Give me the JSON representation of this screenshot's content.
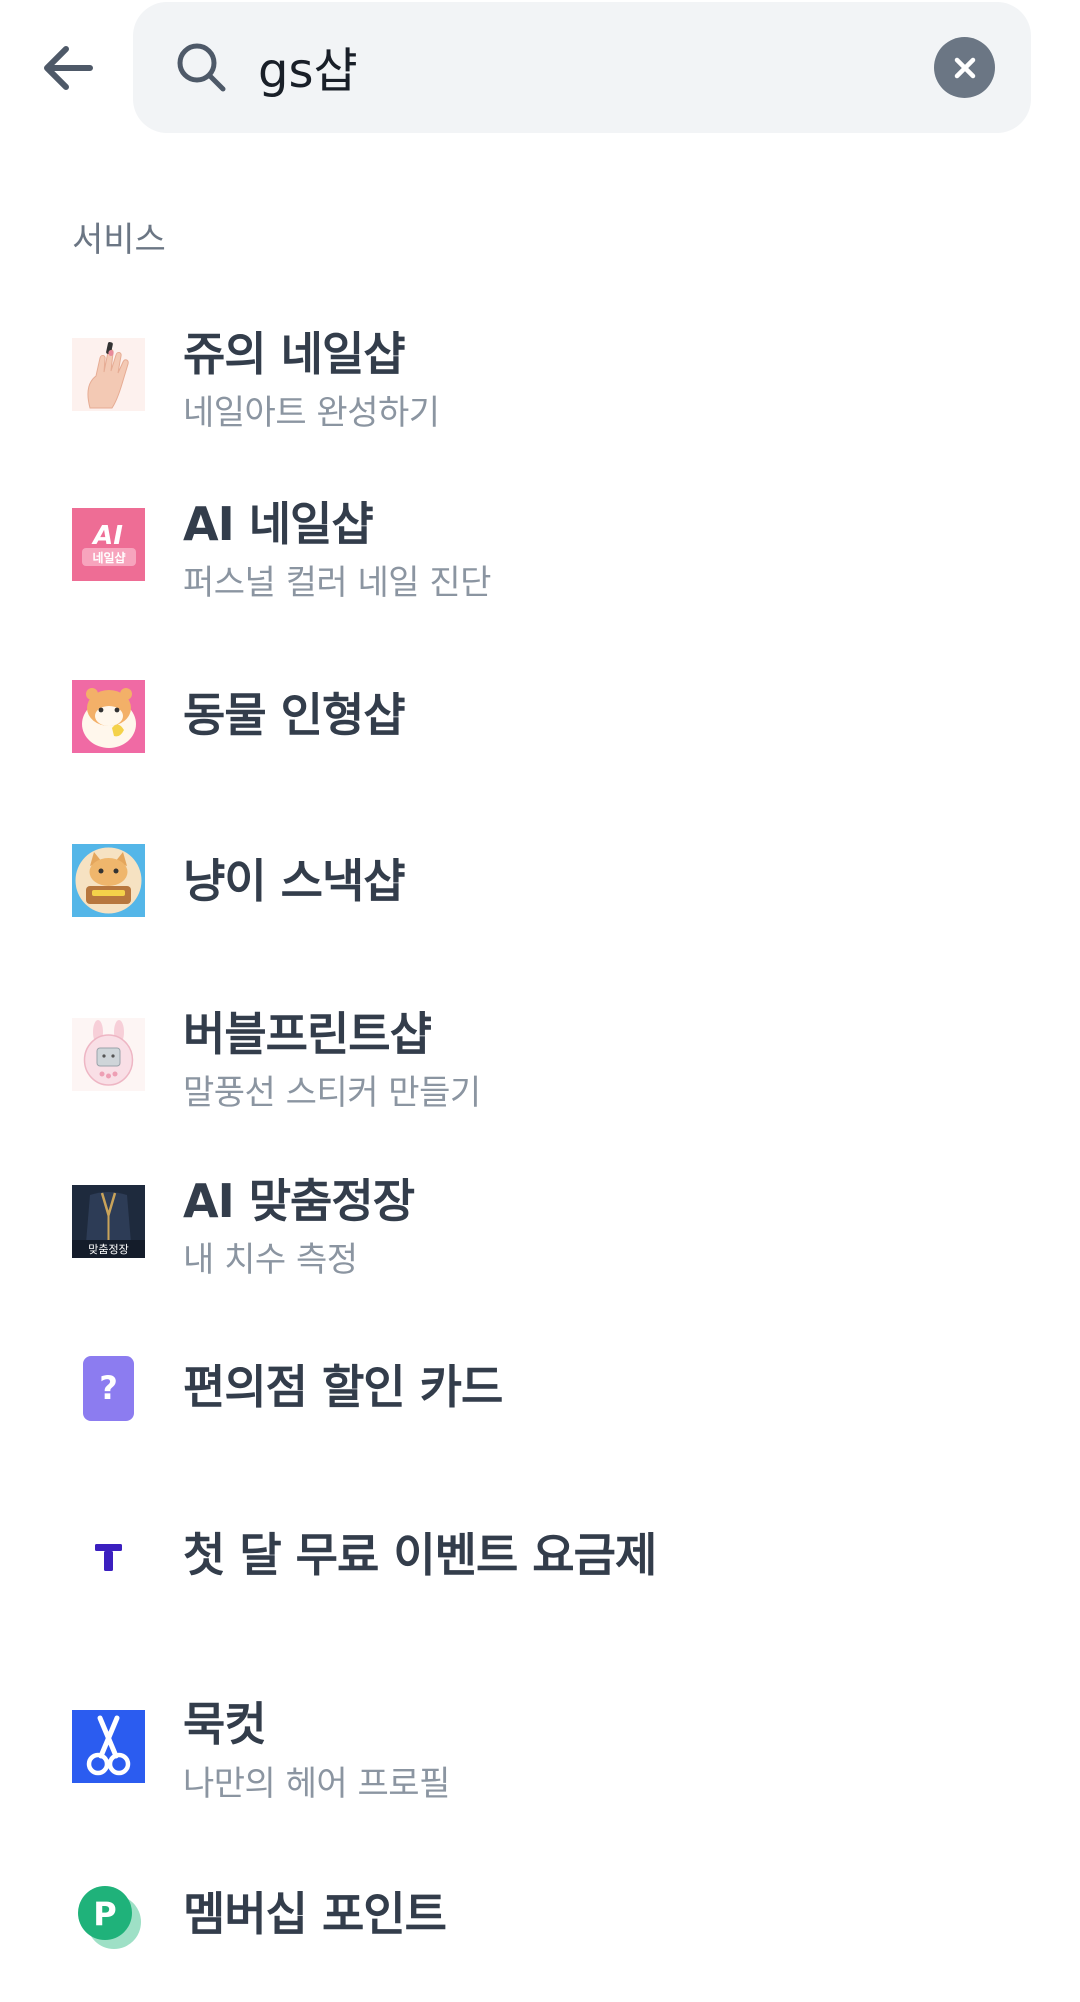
{
  "search": {
    "query": "gs샵"
  },
  "section": {
    "title": "서비스"
  },
  "results": [
    {
      "title": "쥬의 네일샵",
      "subtitle": "네일아트 완성하기",
      "icon": "nail-hand-icon"
    },
    {
      "title": "AI 네일샵",
      "subtitle": "퍼스널 컬러 네일 진단",
      "icon": "ai-nail-logo-icon",
      "icon_text": "네일샵"
    },
    {
      "title": "동물 인형샵",
      "subtitle": "",
      "icon": "hamster-icon"
    },
    {
      "title": "냥이 스낵샵",
      "subtitle": "",
      "icon": "cat-snack-icon"
    },
    {
      "title": "버블프린트샵",
      "subtitle": "말풍선 스티커 만들기",
      "icon": "bunny-camera-icon"
    },
    {
      "title": "AI 맞춤정장",
      "subtitle": "내 치수 측정",
      "icon": "suit-icon",
      "icon_text": "맞춤정장"
    },
    {
      "title": "편의점 할인 카드",
      "subtitle": "",
      "icon": "question-card-icon"
    },
    {
      "title": "첫 달 무료 이벤트 요금제",
      "subtitle": "",
      "icon": "t-logo-icon"
    },
    {
      "title": "묵컷",
      "subtitle": "나만의 헤어 프로필",
      "icon": "scissors-icon"
    },
    {
      "title": "멤버십 포인트",
      "subtitle": "",
      "icon": "p-point-icon"
    }
  ],
  "colors": {
    "search_bg": "#f2f4f6",
    "clear_btn": "#6b7684",
    "title_text": "#333d4b",
    "sub_text": "#8b95a1"
  }
}
